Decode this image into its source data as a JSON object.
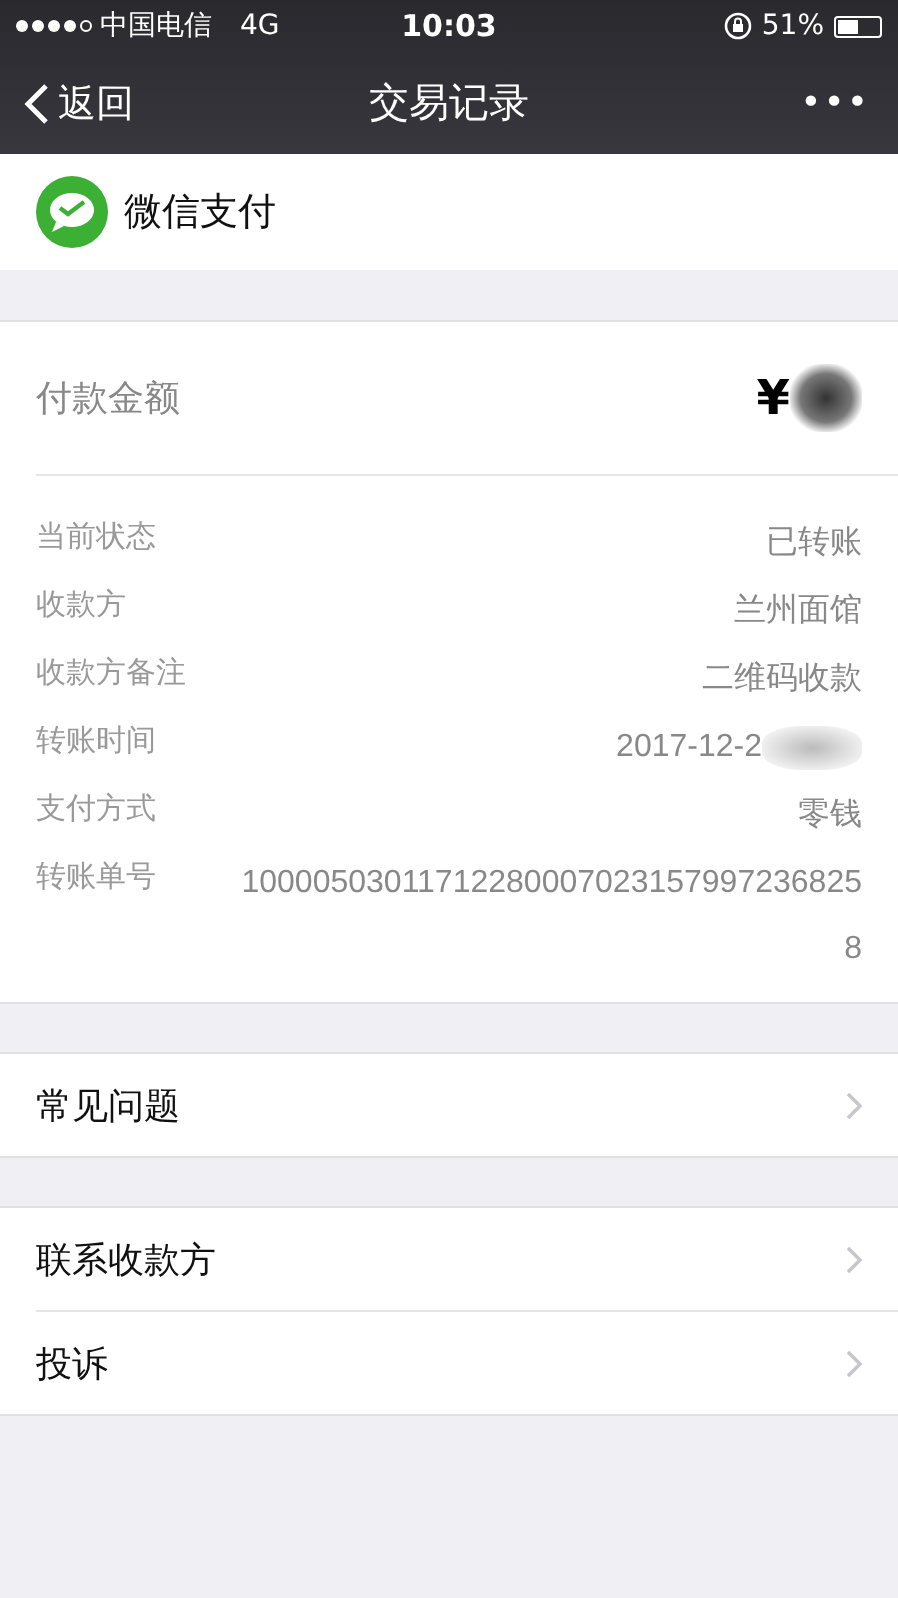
{
  "status_bar": {
    "carrier": "中国电信",
    "network": "4G",
    "time": "10:03",
    "battery": "51%"
  },
  "nav": {
    "back": "返回",
    "title": "交易记录",
    "more": "•••"
  },
  "merchant": {
    "name": "微信支付"
  },
  "amount": {
    "label": "付款金额",
    "value": "¥",
    "redacted": true
  },
  "details": [
    {
      "label": "当前状态",
      "value": "已转账",
      "redacted": false
    },
    {
      "label": "收款方",
      "value": "兰州面馆",
      "redacted": false
    },
    {
      "label": "收款方备注",
      "value": "二维码收款",
      "redacted": false
    },
    {
      "label": "转账时间",
      "value": "2017-12-2",
      "redacted": true
    },
    {
      "label": "支付方式",
      "value": "零钱",
      "redacted": false
    },
    {
      "label": "转账单号",
      "value": "100005030117122800070231579972368258",
      "redacted": false
    }
  ],
  "groups": [
    [
      {
        "label": "常见问题"
      }
    ],
    [
      {
        "label": "联系收款方"
      },
      {
        "label": "投诉"
      }
    ]
  ]
}
